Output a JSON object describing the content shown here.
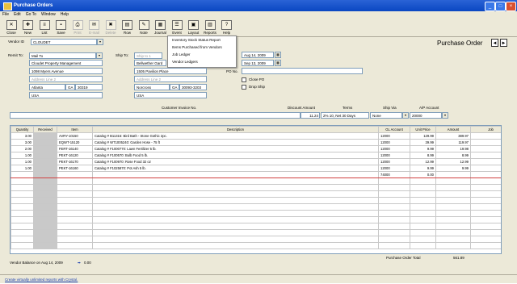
{
  "window": {
    "title": "Purchase Orders"
  },
  "menubar": [
    "File",
    "Edit",
    "Go To",
    "Window",
    "Help"
  ],
  "toolbar": [
    {
      "label": "Close",
      "icon": "close-icon",
      "glyph": "✕",
      "enabled": true
    },
    {
      "label": "New",
      "icon": "new-icon",
      "glyph": "✚",
      "enabled": true
    },
    {
      "label": "List",
      "icon": "list-icon",
      "glyph": "≡",
      "enabled": true
    },
    {
      "label": "Save",
      "icon": "save-icon",
      "glyph": "▪",
      "enabled": true
    },
    {
      "label": "Print",
      "icon": "print-icon",
      "glyph": "⎙",
      "enabled": false
    },
    {
      "label": "E-mail",
      "icon": "email-icon",
      "glyph": "✉",
      "enabled": false
    },
    {
      "label": "Delete",
      "icon": "delete-icon",
      "glyph": "✖",
      "enabled": false
    },
    {
      "label": "Row",
      "icon": "row-icon",
      "glyph": "▤",
      "enabled": true
    },
    {
      "label": "Note",
      "icon": "note-icon",
      "glyph": "✎",
      "enabled": true
    },
    {
      "label": "Journal",
      "icon": "journal-icon",
      "glyph": "▦",
      "enabled": true
    },
    {
      "label": "Event",
      "icon": "event-icon",
      "glyph": "☰",
      "enabled": true
    },
    {
      "label": "Layout",
      "icon": "layout-icon",
      "glyph": "▣",
      "enabled": true
    },
    {
      "label": "Reports",
      "icon": "reports-icon",
      "glyph": "▥",
      "enabled": true
    },
    {
      "label": "Help",
      "icon": "help-icon",
      "glyph": "?",
      "enabled": true
    }
  ],
  "reports_menu": [
    "Inventory Stock Status Report",
    "Items Purchased from Vendors",
    "Job Ledger",
    "Vendor Ledgers"
  ],
  "vendor": {
    "label": "Vendor ID",
    "value": "CLOUDET"
  },
  "form_title": "Purchase Order",
  "nav": {
    "prev": "◄",
    "next": "►"
  },
  "remit_to": {
    "label": "Remit To:",
    "type": "Mail To",
    "name": "Cloudet Property Management",
    "address1": "1098 Myers Avenue",
    "address2_placeholder": "Address Line 2",
    "city": "Atlanta",
    "state": "GA",
    "zip": "30319",
    "country": "USA"
  },
  "ship_to": {
    "label": "Ship To:",
    "type_placeholder": "Ship to 1",
    "name": "Bellwether Gard",
    "address1": "1505 Pavilion Place",
    "address2_placeholder": "Address Line 2",
    "city": "Norcross",
    "state": "GA",
    "zip": "30093-3203",
    "country": "USA"
  },
  "date": "Aug 14, 2009",
  "good_thru": "Sep 13, 2009",
  "po_no_label": "PO No.",
  "close_po_label": "Close PO",
  "drop_ship_label": "Drop Ship",
  "customer_invoice_label": "Customer Invoice No.",
  "discount": {
    "label": "Discount Amount",
    "amount": "11.24",
    "terms_label": "Terms",
    "terms": "2% 10, Net 30 Days"
  },
  "ship_via": {
    "label": "Ship Via",
    "value": "None"
  },
  "ap_account": {
    "label": "A/P Account",
    "value": "20000"
  },
  "grid": {
    "headers": [
      "Quantity",
      "Received",
      "Item",
      "Description",
      "GL Account",
      "Unit Price",
      "Amount",
      "Job"
    ],
    "rows": [
      {
        "qty": "3.00",
        "rcv": "",
        "item": "AVRY-10150",
        "desc": "Catalog # B11315: Bird Bath - Stone Gothic 2pc.",
        "gl": "12000",
        "price": "129.99",
        "amount": "389.97",
        "job": ""
      },
      {
        "qty": "3.00",
        "rcv": "",
        "item": "EQWT-15120",
        "desc": "Catalog # WT1005240: Garden Hose - 75 ft",
        "gl": "12000",
        "price": "39.99",
        "amount": "119.97",
        "job": ""
      },
      {
        "qty": "2.00",
        "rcv": "",
        "item": "FERT-16140",
        "desc": "Catalog # F1000770: Lawn Fertilizer 5 lb.",
        "gl": "12000",
        "price": "9.99",
        "amount": "19.98",
        "job": ""
      },
      {
        "qty": "1.00",
        "rcv": "",
        "item": "PEKT-16120",
        "desc": "Catalog # F100570: Bulb Food 5 lb.",
        "gl": "12000",
        "price": "8.99",
        "amount": "8.99",
        "job": ""
      },
      {
        "qty": "1.00",
        "rcv": "",
        "item": "PEKT-16170",
        "desc": "Catalog # F100970: Rose Food 32 oz",
        "gl": "12000",
        "price": "12.99",
        "amount": "12.99",
        "job": ""
      },
      {
        "qty": "1.00",
        "rcv": "",
        "item": "PEKT-16160",
        "desc": "Catalog # F1025870: Pot Ash 5 lb.",
        "gl": "12000",
        "price": "9.99",
        "amount": "9.99",
        "job": ""
      },
      {
        "qty": "",
        "rcv": "",
        "item": "",
        "desc": "",
        "gl": "74000",
        "price": "0.00",
        "amount": "",
        "job": ""
      }
    ],
    "empty_rows": 11
  },
  "footer": {
    "vendor_balance_label": "Vendor Balance on Aug 14, 2009",
    "vendor_balance": "0.00",
    "total_label": "Purchase Order Total",
    "total": "561.89"
  },
  "status_link": "Create virtually unlimited reports with Crystal."
}
